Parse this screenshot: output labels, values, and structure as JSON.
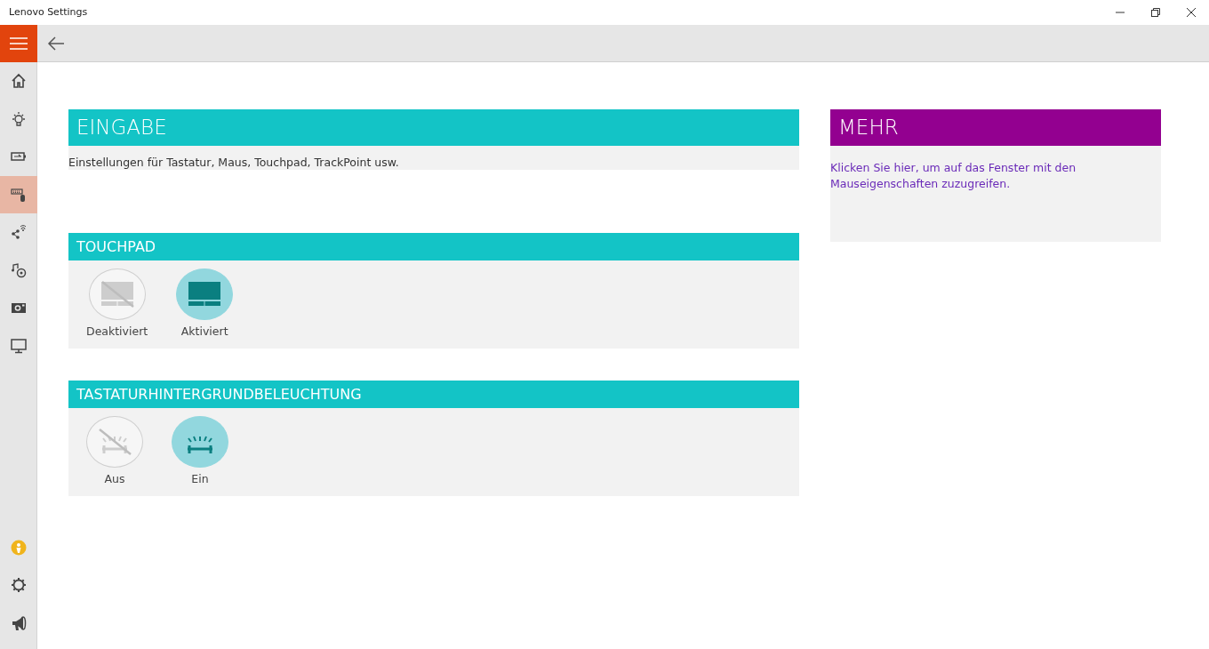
{
  "window": {
    "title": "Lenovo Settings"
  },
  "sidebar": {
    "items": [
      {
        "kind": "home",
        "selected": false
      },
      {
        "kind": "bulb",
        "selected": false
      },
      {
        "kind": "battery",
        "selected": false
      },
      {
        "kind": "keyboard",
        "selected": true
      },
      {
        "kind": "network",
        "selected": false
      },
      {
        "kind": "media",
        "selected": false
      },
      {
        "kind": "camera",
        "selected": false
      },
      {
        "kind": "monitor",
        "selected": false
      }
    ],
    "bottom_items": [
      {
        "kind": "badge"
      },
      {
        "kind": "settings"
      },
      {
        "kind": "megaphone"
      }
    ]
  },
  "page": {
    "title": "EINGABE",
    "description": "Einstellungen für Tastatur, Maus, Touchpad, TrackPoint usw."
  },
  "sections": [
    {
      "title": "TOUCHPAD",
      "kind": "touchpad",
      "options": [
        {
          "label": "Deaktiviert",
          "kind": "off",
          "selected": false
        },
        {
          "label": "Aktiviert",
          "kind": "on",
          "selected": true
        }
      ]
    },
    {
      "title": "TASTATURHINTERGRUNDBELEUCHTUNG",
      "kind": "backlight",
      "options": [
        {
          "label": "Aus",
          "kind": "off",
          "selected": false
        },
        {
          "label": "Ein",
          "kind": "on",
          "selected": true
        }
      ]
    }
  ],
  "more": {
    "title": "MEHR",
    "link": "Klicken Sie hier, um auf das Fenster mit den Mauseigenschaften zuzugreifen."
  }
}
